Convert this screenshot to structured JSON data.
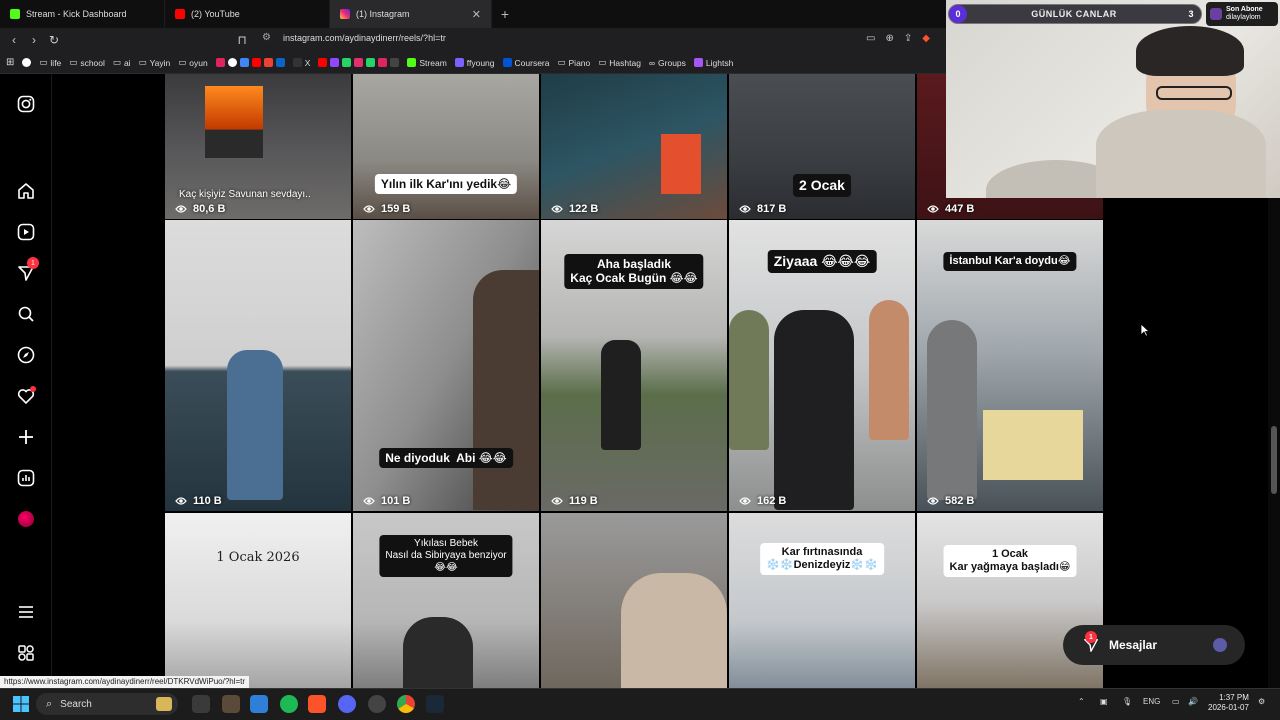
{
  "browser": {
    "tabs": [
      {
        "title": "Stream - Kick Dashboard",
        "color": "#53fc18"
      },
      {
        "title": "(2) YouTube",
        "color": "#ff0000"
      },
      {
        "title": "(1) Instagram",
        "color": "#e1306c"
      }
    ],
    "new_tab": "+",
    "url": "instagram.com/aydinaydinerr/reels/?hl=tr",
    "bookmarks": [
      "life",
      "school",
      "ai",
      "Yayin",
      "oyun",
      "X",
      "Stream",
      "ffyoung",
      "Coursera",
      "Piano",
      "Hashtag",
      "Groups",
      "Lightsh"
    ]
  },
  "instagram": {
    "nav_badge": "1",
    "message_badge": "1",
    "messages_label": "Mesajlar",
    "reels_row1": [
      {
        "caption": "Kaç kişiyiz Savunan sevdayı..",
        "views": "80,6 B",
        "style": "plain"
      },
      {
        "caption": "Yılın ilk Kar'ını yedik😂",
        "views": "159 B",
        "style": "light"
      },
      {
        "caption": "",
        "views": "122 B",
        "style": "none"
      },
      {
        "caption": "2 Ocak",
        "views": "817 B",
        "style": "dark"
      },
      {
        "caption": "",
        "views": "447 B",
        "style": "none"
      }
    ],
    "reels_row2": [
      {
        "caption": "",
        "views": "110 B",
        "style": "none"
      },
      {
        "caption": "Ne diyoduk  Abi 😂😂",
        "views": "101 B",
        "style": "dark"
      },
      {
        "caption": "Aha başladık\nKaç Ocak Bugün 😂😂",
        "views": "119 B",
        "style": "dark"
      },
      {
        "caption": "Ziyaaa 😂😂😂",
        "views": "162 B",
        "style": "dark"
      },
      {
        "caption": "İstanbul Kar'a doydu😂",
        "views": "582 B",
        "style": "dark"
      }
    ],
    "reels_row3": [
      {
        "caption": "1 Ocak 2026",
        "style": "serif"
      },
      {
        "caption": "Yıkılası Bebek\nNasıl da Sibiryaya benziyor\n😂😂",
        "style": "dark"
      },
      {
        "caption": "",
        "style": "none"
      },
      {
        "caption": "Kar fırtınasında\n❄️❄️Denizdeyiz❄️❄️",
        "style": "light"
      },
      {
        "caption": "1 Ocak\nKar yağmaya başladı😁",
        "style": "light"
      }
    ]
  },
  "status_url": "https://www.instagram.com/aydinaydinerr/reel/DTKRVdWiPuo/?hl=tr",
  "stream_overlay": {
    "goal_count": "0",
    "goal_label": "GÜNLÜK CANLAR",
    "goal_total": "3",
    "last_sub_title": "Son Abone",
    "last_sub_name": "dilaylaylom"
  },
  "taskbar": {
    "search_placeholder": "Search",
    "language": "ENG",
    "time": "1:37 PM",
    "date": "2026-01-07"
  }
}
